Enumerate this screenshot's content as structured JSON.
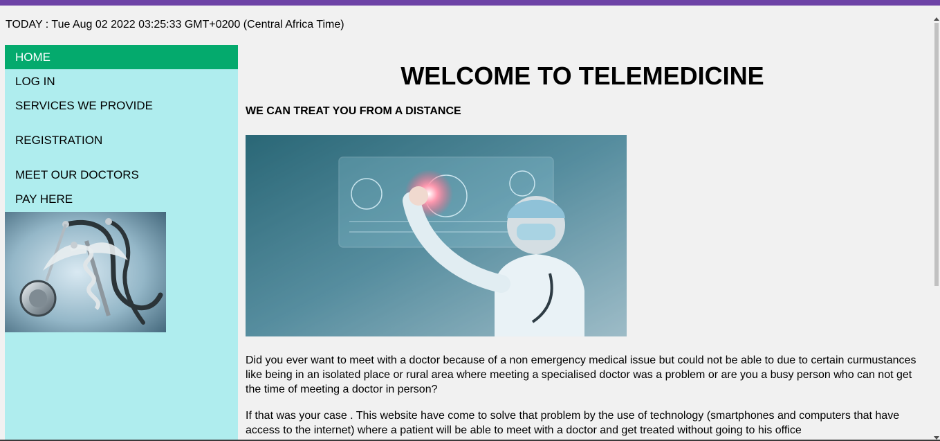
{
  "header": {
    "today_label": "TODAY : Tue Aug 02 2022 03:25:33 GMT+0200 (Central Africa Time)",
    "accent_color": "#6d43a6"
  },
  "sidebar": {
    "active_color": "#04aa6d",
    "background_color": "#afedee",
    "items": [
      {
        "label": "HOME",
        "active": true
      },
      {
        "label": "LOG IN",
        "active": false
      },
      {
        "label": "SERVICES WE PROVIDE",
        "active": false
      },
      {
        "label": "REGISTRATION",
        "active": false
      },
      {
        "label": "MEET OUR DOCTORS",
        "active": false
      },
      {
        "label": "PAY HERE",
        "active": false
      }
    ],
    "image_icon": "stethoscope-caduceus-image"
  },
  "main": {
    "title": "WELCOME TO TELEMEDICINE",
    "subtitle": "WE CAN TREAT YOU FROM A DISTANCE",
    "hero_image_icon": "doctor-digital-interface-image",
    "paragraphs": [
      "Did you ever want to meet with a doctor because of a non emergency medical issue but could not be able to due to certain curmustances like being in an isolated place or rural area where meeting a specialised doctor was a problem or are you a busy person who can not get the time of meeting a doctor in person?",
      "If that was your case . This website have come to solve that problem by the use of technology (smartphones and computers that have access to the internet) where a patient will be able to meet with a doctor and get treated without going to his office"
    ]
  }
}
